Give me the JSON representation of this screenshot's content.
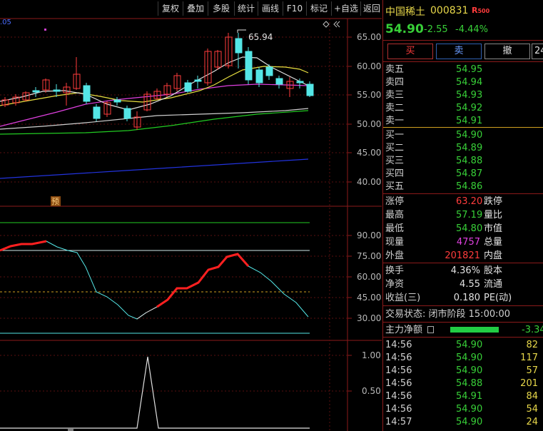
{
  "toolbar": {
    "buttons": [
      "复权",
      "叠加",
      "多股",
      "统计",
      "画线",
      "F10",
      "标记",
      "+自选",
      "返回"
    ]
  },
  "chart": {
    "corner_label": ".05",
    "price_ticks": [
      "65.00",
      "60.00",
      "55.00",
      "50.00",
      "45.00",
      "40.00"
    ],
    "max_label": "65.94",
    "forecast_badge": "预",
    "indicator_ticks": [
      "90.00",
      "75.00",
      "60.00",
      "45.00",
      "30.00"
    ],
    "volume_ticks": [
      "1.00",
      "0.50"
    ]
  },
  "quote": {
    "name": "中国稀土",
    "code": "000831",
    "tag": "R",
    "tag_sub": "500",
    "price": "54.90",
    "change": "-2.55",
    "change_pct": "-4.44%",
    "buy_label": "买",
    "sell_label": "卖",
    "cancel_label": "撤",
    "extra_label": "24"
  },
  "asks": [
    {
      "label": "卖五",
      "price": "54.95"
    },
    {
      "label": "卖四",
      "price": "54.94"
    },
    {
      "label": "卖三",
      "price": "54.93"
    },
    {
      "label": "卖二",
      "price": "54.92"
    },
    {
      "label": "卖一",
      "price": "54.91"
    }
  ],
  "bids": [
    {
      "label": "买一",
      "price": "54.90"
    },
    {
      "label": "买二",
      "price": "54.89"
    },
    {
      "label": "买三",
      "price": "54.88"
    },
    {
      "label": "买四",
      "price": "54.87"
    },
    {
      "label": "买五",
      "price": "54.86"
    }
  ],
  "stats1": [
    {
      "label": "涨停",
      "value": "63.20",
      "right_label": "跌停"
    },
    {
      "label": "最高",
      "value": "57.19",
      "right_label": "量比"
    },
    {
      "label": "最低",
      "value": "54.80",
      "right_label": "市值"
    },
    {
      "label": "现量",
      "value": "4757",
      "right_label": "总量"
    },
    {
      "label": "外盘",
      "value": "201821",
      "right_label": "内盘"
    }
  ],
  "stats2": [
    {
      "label": "换手",
      "value": "4.36%",
      "right_label": "股本"
    },
    {
      "label": "净资",
      "value": "4.55",
      "right_label": "流通"
    },
    {
      "label": "收益(三)",
      "value": "0.180",
      "right_label": "PE(动)"
    }
  ],
  "status": {
    "label": "交易状态: 闭市阶段 15:00:00"
  },
  "main_flow": {
    "label": "主力净额",
    "value": "-3.34"
  },
  "ticks": [
    {
      "time": "14:56",
      "price": "54.90",
      "vol": "82"
    },
    {
      "time": "14:56",
      "price": "54.90",
      "vol": "117"
    },
    {
      "time": "14:56",
      "price": "54.90",
      "vol": "57"
    },
    {
      "time": "14:56",
      "price": "54.88",
      "vol": "201"
    },
    {
      "time": "14:56",
      "price": "54.91",
      "vol": "84"
    },
    {
      "time": "14:56",
      "price": "54.90",
      "vol": "54"
    },
    {
      "time": "14:57",
      "price": "54.90",
      "vol": "24"
    }
  ],
  "colors": {
    "up": "#ff3c3c",
    "down": "#54e6e6",
    "grid": "#8b1a1a",
    "green": "#38d038"
  }
}
